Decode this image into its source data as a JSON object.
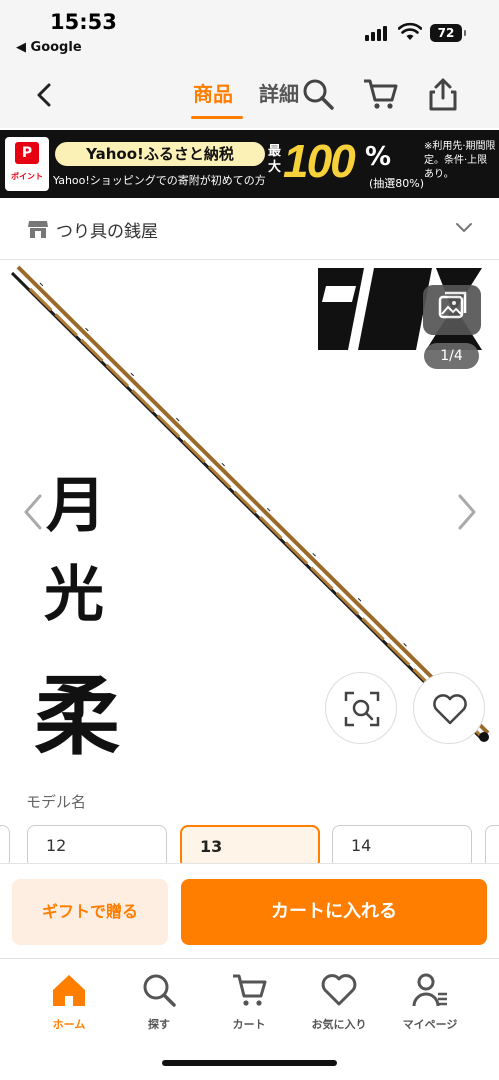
{
  "status_bar": {
    "time": "15:53",
    "back_app": "◀ Google",
    "battery": "72"
  },
  "header": {
    "tabs": [
      {
        "label": "商品",
        "active": true
      },
      {
        "label": "詳細",
        "active": false
      }
    ],
    "icons": [
      "back-chevron-icon",
      "search-icon",
      "cart-icon",
      "share-icon"
    ],
    "accent_color": "#ff7e00"
  },
  "banner": {
    "paypay_label": "ポイント",
    "headline": "Yahoo!ふるさと納税",
    "subline": "Yahoo!ショッピングでの寄附が初めての方",
    "max_label": "最大",
    "big_number": "100",
    "percent": "%",
    "lottery": "(抽選80%)",
    "note": "※利用先·期間限定。条件·上限あり。"
  },
  "store": {
    "name": "つり具の銭屋"
  },
  "gallery": {
    "counter": "1/4",
    "kanji": [
      "月",
      "光",
      "柔"
    ]
  },
  "model": {
    "label": "モデル名",
    "options": [
      {
        "label": "12",
        "selected": false
      },
      {
        "label": "13",
        "selected": true
      },
      {
        "label": "14",
        "selected": false
      }
    ]
  },
  "actions": {
    "gift": "ギフトで贈る",
    "add_to_cart": "カートに入れる"
  },
  "bottom_nav": {
    "items": [
      {
        "label": "ホーム",
        "icon": "home-icon",
        "active": true
      },
      {
        "label": "探す",
        "icon": "search-icon",
        "active": false
      },
      {
        "label": "カート",
        "icon": "cart-icon",
        "active": false
      },
      {
        "label": "お気に入り",
        "icon": "heart-icon",
        "active": false
      },
      {
        "label": "マイページ",
        "icon": "user-icon",
        "active": false
      }
    ]
  }
}
